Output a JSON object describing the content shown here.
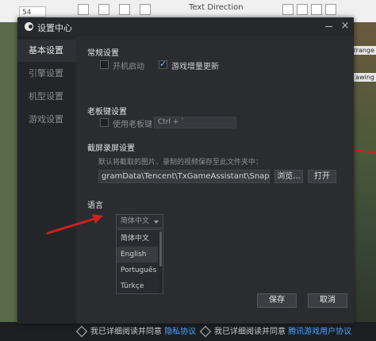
{
  "background": {
    "font_size": "54",
    "text_direction": "Text Direction",
    "right_labels": [
      "rrange",
      "awing"
    ]
  },
  "bottom_bar": {
    "items": [
      {
        "text": "我已详细阅读并同意",
        "link": "隐私协议"
      },
      {
        "text": "我已详细阅读并同意",
        "link": "腾讯游戏用户协议"
      }
    ]
  },
  "dialog": {
    "title": "设置中心",
    "close_glyph": "×",
    "sidebar": [
      "基本设置",
      "引擎设置",
      "机型设置",
      "游戏设置"
    ],
    "general": {
      "title": "常规设置",
      "autostart_label": "开机启动",
      "autostart_checked": false,
      "incremental_label": "游戏增量更新",
      "incremental_checked": true
    },
    "boss_key": {
      "title": "老板键设置",
      "use_label": "使用老板键",
      "use_checked": false,
      "hotkey": "Ctrl + `"
    },
    "screenshot": {
      "title": "截屏录屏设置",
      "description": "默认将截取的图片、录制的视频保存至此文件夹中：",
      "path": "gramData\\Tencent\\TxGameAssistant\\Snapshot",
      "browse_label": "浏览...",
      "open_label": "打开"
    },
    "language": {
      "title": "语言",
      "selected": "简体中文",
      "options": [
        "简体中文",
        "English",
        "Português",
        "Türkçe"
      ]
    },
    "save_label": "保存",
    "cancel_label": "取消"
  },
  "colors": {
    "accent": "#4aa3ff",
    "annotation": "#d02020"
  }
}
